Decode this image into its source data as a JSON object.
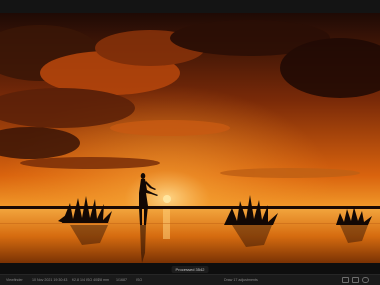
{
  "status": {
    "badge": "Processed 3542",
    "fields": [
      "Viewfinder",
      "10 Nov 2021 19:30:43",
      "f/2.8 1/4 ISO 400",
      "28 mm",
      "1/1687",
      "ISO",
      "Draw 17 adjustments"
    ]
  },
  "colors": {
    "sky_top": "#1e0a05",
    "sun": "#ffd36a",
    "water": "#e07a14",
    "silhouette": "#120804"
  }
}
